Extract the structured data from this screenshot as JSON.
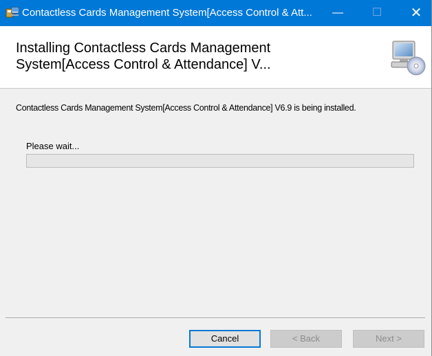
{
  "window": {
    "title": "Contactless Cards Management System[Access Control & Att...",
    "minimize_glyph": "—",
    "maximize_glyph": "☐",
    "close_glyph": "✕"
  },
  "banner": {
    "heading": "Installing Contactless Cards Management System[Access Control & Attendance] V...",
    "icon": "computer-cd-icon"
  },
  "body": {
    "message": "Contactless Cards Management System[Access Control & Attendance] V6.9 is being installed.",
    "wait_label": "Please wait...",
    "progress_percent": 0
  },
  "buttons": {
    "cancel": "Cancel",
    "back": "< Back",
    "next": "Next >"
  },
  "colors": {
    "titlebar": "#0078d7",
    "progress_fill": "#06b025"
  }
}
